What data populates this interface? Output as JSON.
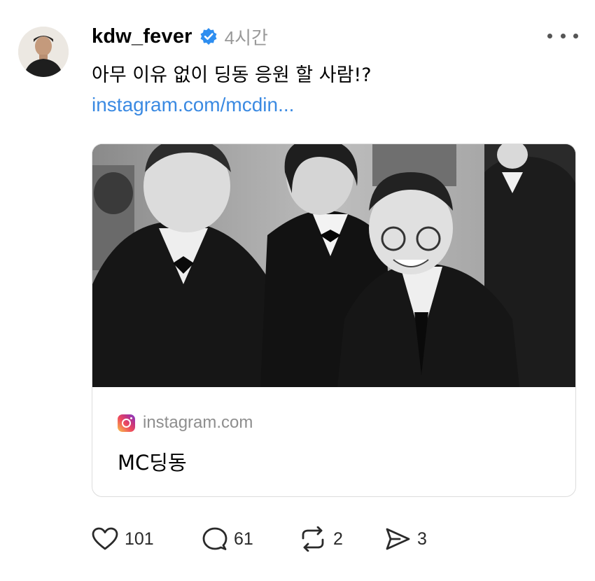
{
  "post": {
    "username": "kdw_fever",
    "timestamp": "4시간",
    "text": "아무 이유 없이 딩동 응원 할 사람!?",
    "link": "instagram.com/mcdin...",
    "card": {
      "domain": "instagram.com",
      "title": "MC딩동"
    },
    "actions": {
      "likes": "101",
      "replies": "61",
      "reposts": "2",
      "shares": "3"
    }
  },
  "icons": {
    "verified": "verified-badge-icon",
    "more": "more-options-icon",
    "source": "instagram-icon",
    "like": "heart-icon",
    "reply": "comment-bubble-icon",
    "repost": "repost-icon",
    "share": "send-icon"
  },
  "colors": {
    "link": "#3b8ae2",
    "verified": "#2e8ef0",
    "timestamp": "#999999"
  }
}
